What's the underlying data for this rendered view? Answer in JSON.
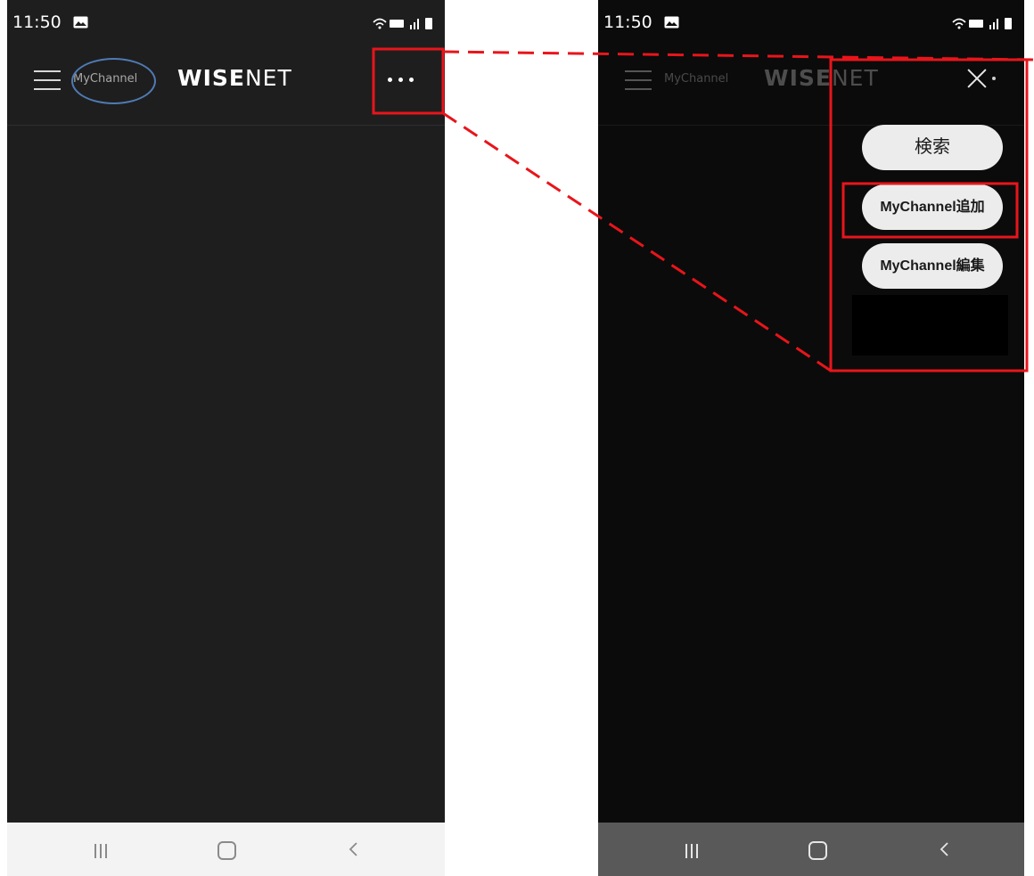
{
  "left_screen": {
    "status": {
      "time": "11:50"
    },
    "appbar": {
      "channel_label": "MyChannel",
      "logo": {
        "bold": "WISE",
        "light": "NET"
      }
    }
  },
  "right_screen": {
    "status": {
      "time": "11:50"
    },
    "appbar": {
      "channel_label": "MyChannel",
      "logo": {
        "bold": "WISE",
        "light": "NET"
      }
    },
    "menu": {
      "search_label": "検索",
      "add_label": "MyChannel追加",
      "edit_label": "MyChannel編集"
    }
  },
  "colors": {
    "left_background": "#1e1e1e",
    "right_background": "#0b0b0b",
    "highlight_red": "#e8151b",
    "circle_blue": "#4f7ab3",
    "menu_pill": "#ececec"
  }
}
